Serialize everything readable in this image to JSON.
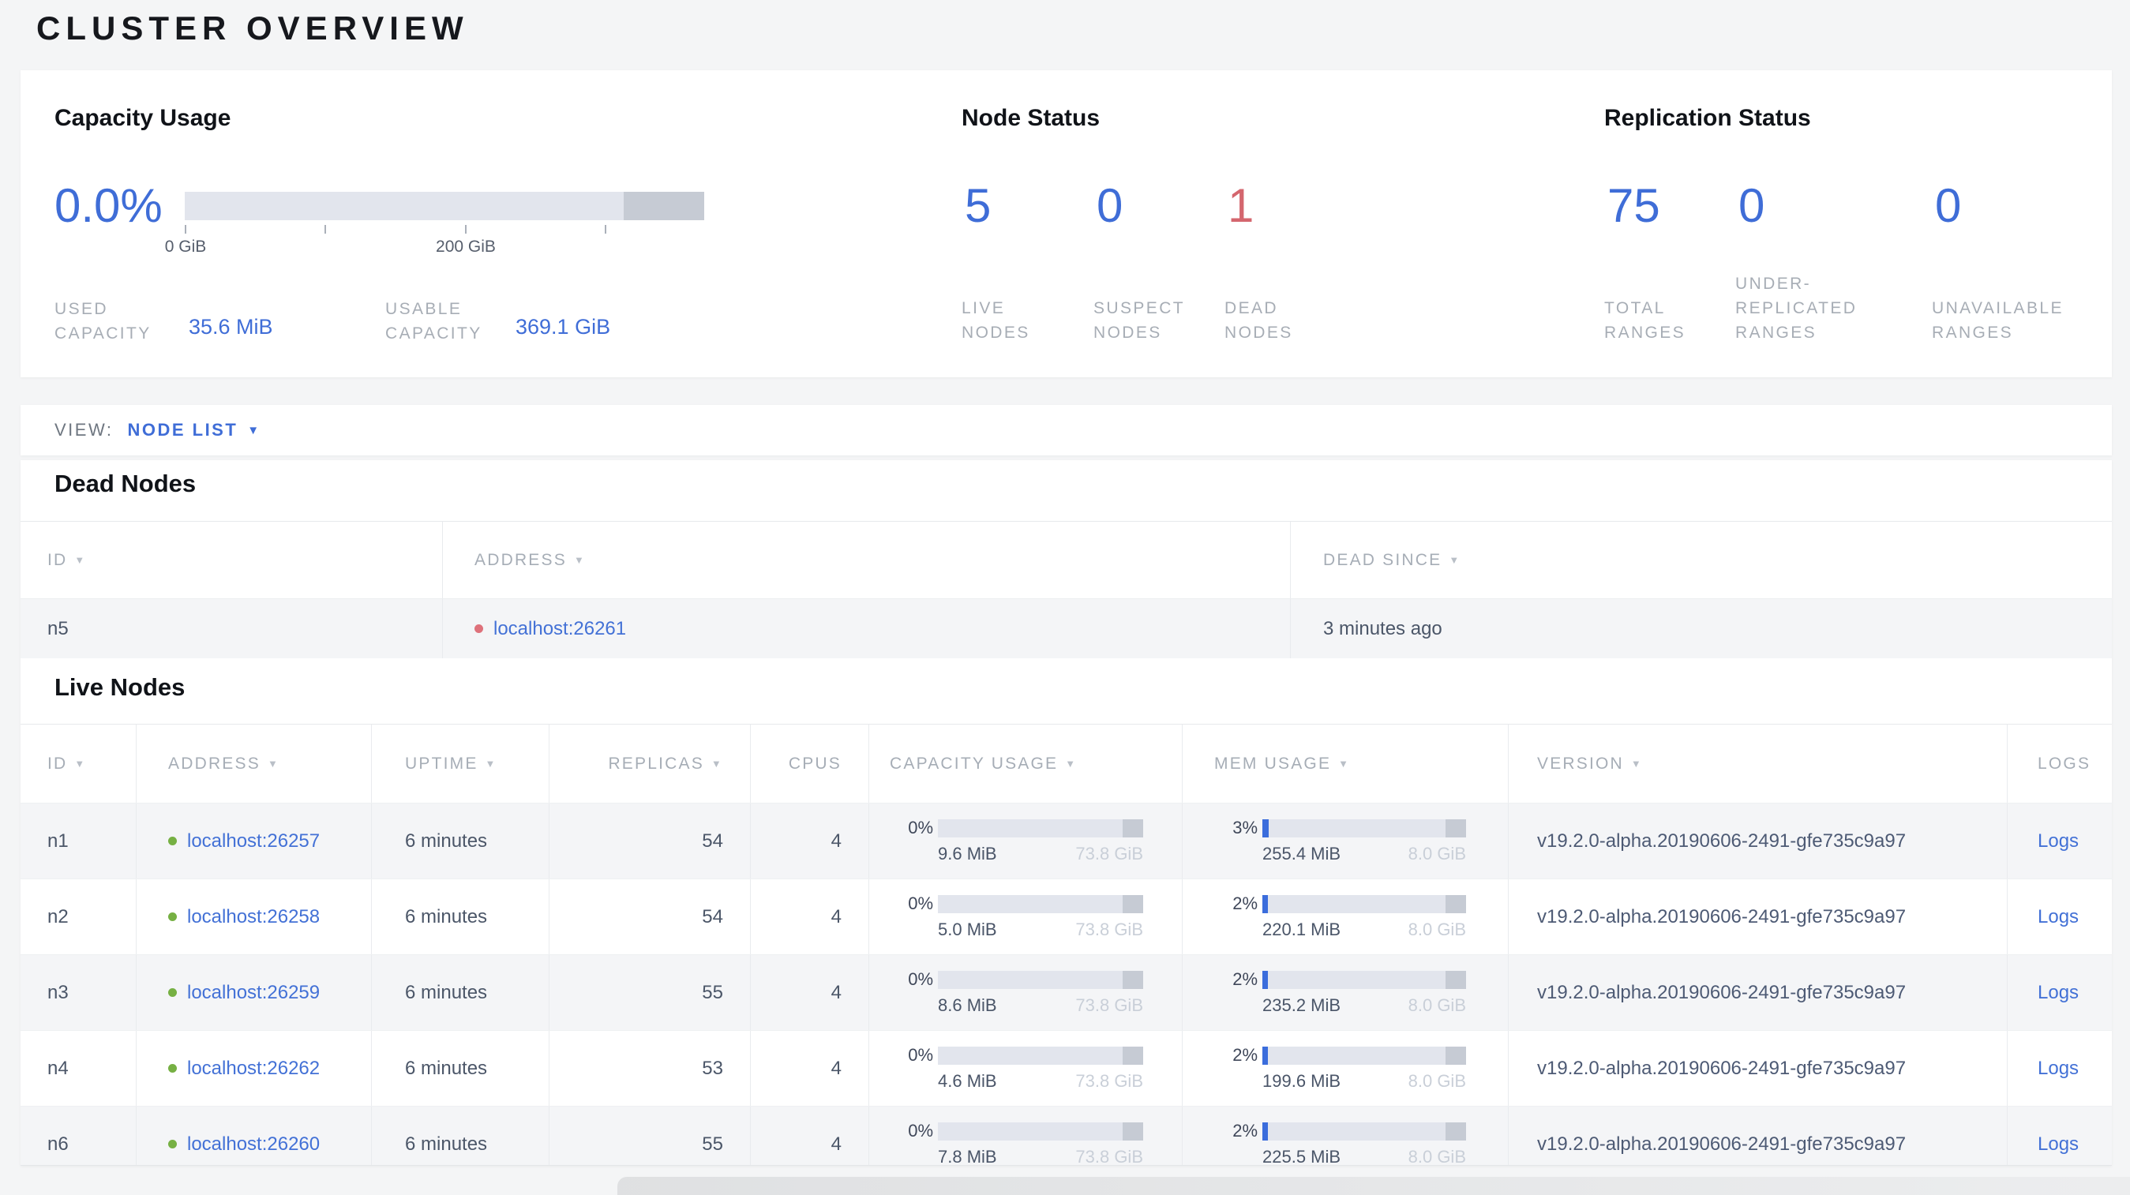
{
  "page": {
    "title": "CLUSTER OVERVIEW"
  },
  "colors": {
    "accent_blue": "#3f6dd7",
    "danger_red": "#d4666e",
    "live_green": "#76b043",
    "dead_dot_red": "#de717b",
    "bar_track": "#e2e5ed",
    "bar_dark_segment": "#c6cbd4",
    "page_background": "#f4f5f6"
  },
  "summary": {
    "capacity": {
      "title": "Capacity Usage",
      "used_percent": "0.0%",
      "axis_labels": [
        "0 GiB",
        "200 GiB"
      ],
      "used_label": "USED CAPACITY",
      "used_value": "35.6 MiB",
      "usable_label": "USABLE CAPACITY",
      "usable_value": "369.1 GiB"
    },
    "node_status": {
      "title": "Node Status",
      "stats": [
        {
          "value": "5",
          "label": "LIVE NODES"
        },
        {
          "value": "0",
          "label": "SUSPECT NODES"
        },
        {
          "value": "1",
          "label": "DEAD NODES"
        }
      ]
    },
    "replication": {
      "title": "Replication Status",
      "stats": [
        {
          "value": "75",
          "label": "TOTAL RANGES"
        },
        {
          "value": "0",
          "label": "UNDER-REPLICATED RANGES"
        },
        {
          "value": "0",
          "label": "UNAVAILABLE RANGES"
        }
      ]
    }
  },
  "view_bar": {
    "label": "VIEW:",
    "selected": "NODE LIST"
  },
  "dead_nodes": {
    "heading": "Dead Nodes",
    "columns": {
      "id": "ID",
      "address": "ADDRESS",
      "dead_since": "DEAD SINCE"
    },
    "rows": [
      {
        "id": "n5",
        "address": "localhost:26261",
        "dead_since": "3 minutes ago"
      }
    ]
  },
  "live_nodes": {
    "heading": "Live Nodes",
    "columns": {
      "id": "ID",
      "address": "ADDRESS",
      "uptime": "UPTIME",
      "replicas": "REPLICAS",
      "cpus": "CPUS",
      "capacity": "CAPACITY USAGE",
      "mem": "MEM USAGE",
      "version": "VERSION",
      "logs": "LOGS"
    },
    "rows": [
      {
        "id": "n1",
        "address": "localhost:26257",
        "uptime": "6 minutes",
        "replicas": "54",
        "cpus": "4",
        "capacity": {
          "percent": "0%",
          "fill_pct": 0,
          "used": "9.6 MiB",
          "total": "73.8 GiB"
        },
        "mem": {
          "percent": "3%",
          "fill_pct": 3,
          "used": "255.4 MiB",
          "total": "8.0 GiB"
        },
        "version": "v19.2.0-alpha.20190606-2491-gfe735c9a97",
        "logs": "Logs"
      },
      {
        "id": "n2",
        "address": "localhost:26258",
        "uptime": "6 minutes",
        "replicas": "54",
        "cpus": "4",
        "capacity": {
          "percent": "0%",
          "fill_pct": 0,
          "used": "5.0 MiB",
          "total": "73.8 GiB"
        },
        "mem": {
          "percent": "2%",
          "fill_pct": 2,
          "used": "220.1 MiB",
          "total": "8.0 GiB"
        },
        "version": "v19.2.0-alpha.20190606-2491-gfe735c9a97",
        "logs": "Logs"
      },
      {
        "id": "n3",
        "address": "localhost:26259",
        "uptime": "6 minutes",
        "replicas": "55",
        "cpus": "4",
        "capacity": {
          "percent": "0%",
          "fill_pct": 0,
          "used": "8.6 MiB",
          "total": "73.8 GiB"
        },
        "mem": {
          "percent": "2%",
          "fill_pct": 2,
          "used": "235.2 MiB",
          "total": "8.0 GiB"
        },
        "version": "v19.2.0-alpha.20190606-2491-gfe735c9a97",
        "logs": "Logs"
      },
      {
        "id": "n4",
        "address": "localhost:26262",
        "uptime": "6 minutes",
        "replicas": "53",
        "cpus": "4",
        "capacity": {
          "percent": "0%",
          "fill_pct": 0,
          "used": "4.6 MiB",
          "total": "73.8 GiB"
        },
        "mem": {
          "percent": "2%",
          "fill_pct": 2,
          "used": "199.6 MiB",
          "total": "8.0 GiB"
        },
        "version": "v19.2.0-alpha.20190606-2491-gfe735c9a97",
        "logs": "Logs"
      },
      {
        "id": "n6",
        "address": "localhost:26260",
        "uptime": "6 minutes",
        "replicas": "55",
        "cpus": "4",
        "capacity": {
          "percent": "0%",
          "fill_pct": 0,
          "used": "7.8 MiB",
          "total": "73.8 GiB"
        },
        "mem": {
          "percent": "2%",
          "fill_pct": 2,
          "used": "225.5 MiB",
          "total": "8.0 GiB"
        },
        "version": "v19.2.0-alpha.20190606-2491-gfe735c9a97",
        "logs": "Logs"
      }
    ]
  }
}
